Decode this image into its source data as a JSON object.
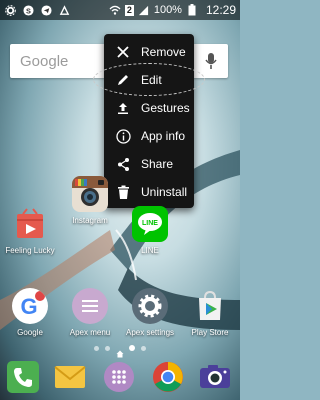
{
  "status_bar": {
    "battery": "100%",
    "time": "12:29",
    "sim_slot": "2",
    "icons": [
      "settings-icon",
      "skype-icon",
      "telegram-icon",
      "triangle-icon",
      "wifi-icon",
      "battery-icon",
      "signal-icon"
    ]
  },
  "search": {
    "label": "Google"
  },
  "context_menu": {
    "items": [
      {
        "label": "Remove",
        "icon": "close-icon"
      },
      {
        "label": "Edit",
        "icon": "pencil-icon"
      },
      {
        "label": "Gestures",
        "icon": "upload-icon"
      },
      {
        "label": "App info",
        "icon": "info-icon"
      },
      {
        "label": "Share",
        "icon": "share-icon"
      },
      {
        "label": "Uninstall",
        "icon": "trash-icon"
      }
    ]
  },
  "home_apps": [
    {
      "label": "Feeling Lucky"
    },
    {
      "label": "Instagram"
    },
    {
      "label": "LINE"
    },
    {
      "label": "Google"
    },
    {
      "label": "Apex menu"
    },
    {
      "label": "Apex settings"
    },
    {
      "label": "Play Store"
    }
  ],
  "dock": [
    "phone-icon",
    "email-icon",
    "apps-drawer-icon",
    "chrome-icon",
    "camera-icon"
  ],
  "colors": {
    "menu_bg": "#151515",
    "line_green": "#00c300",
    "play_green": "#3bb24a"
  }
}
